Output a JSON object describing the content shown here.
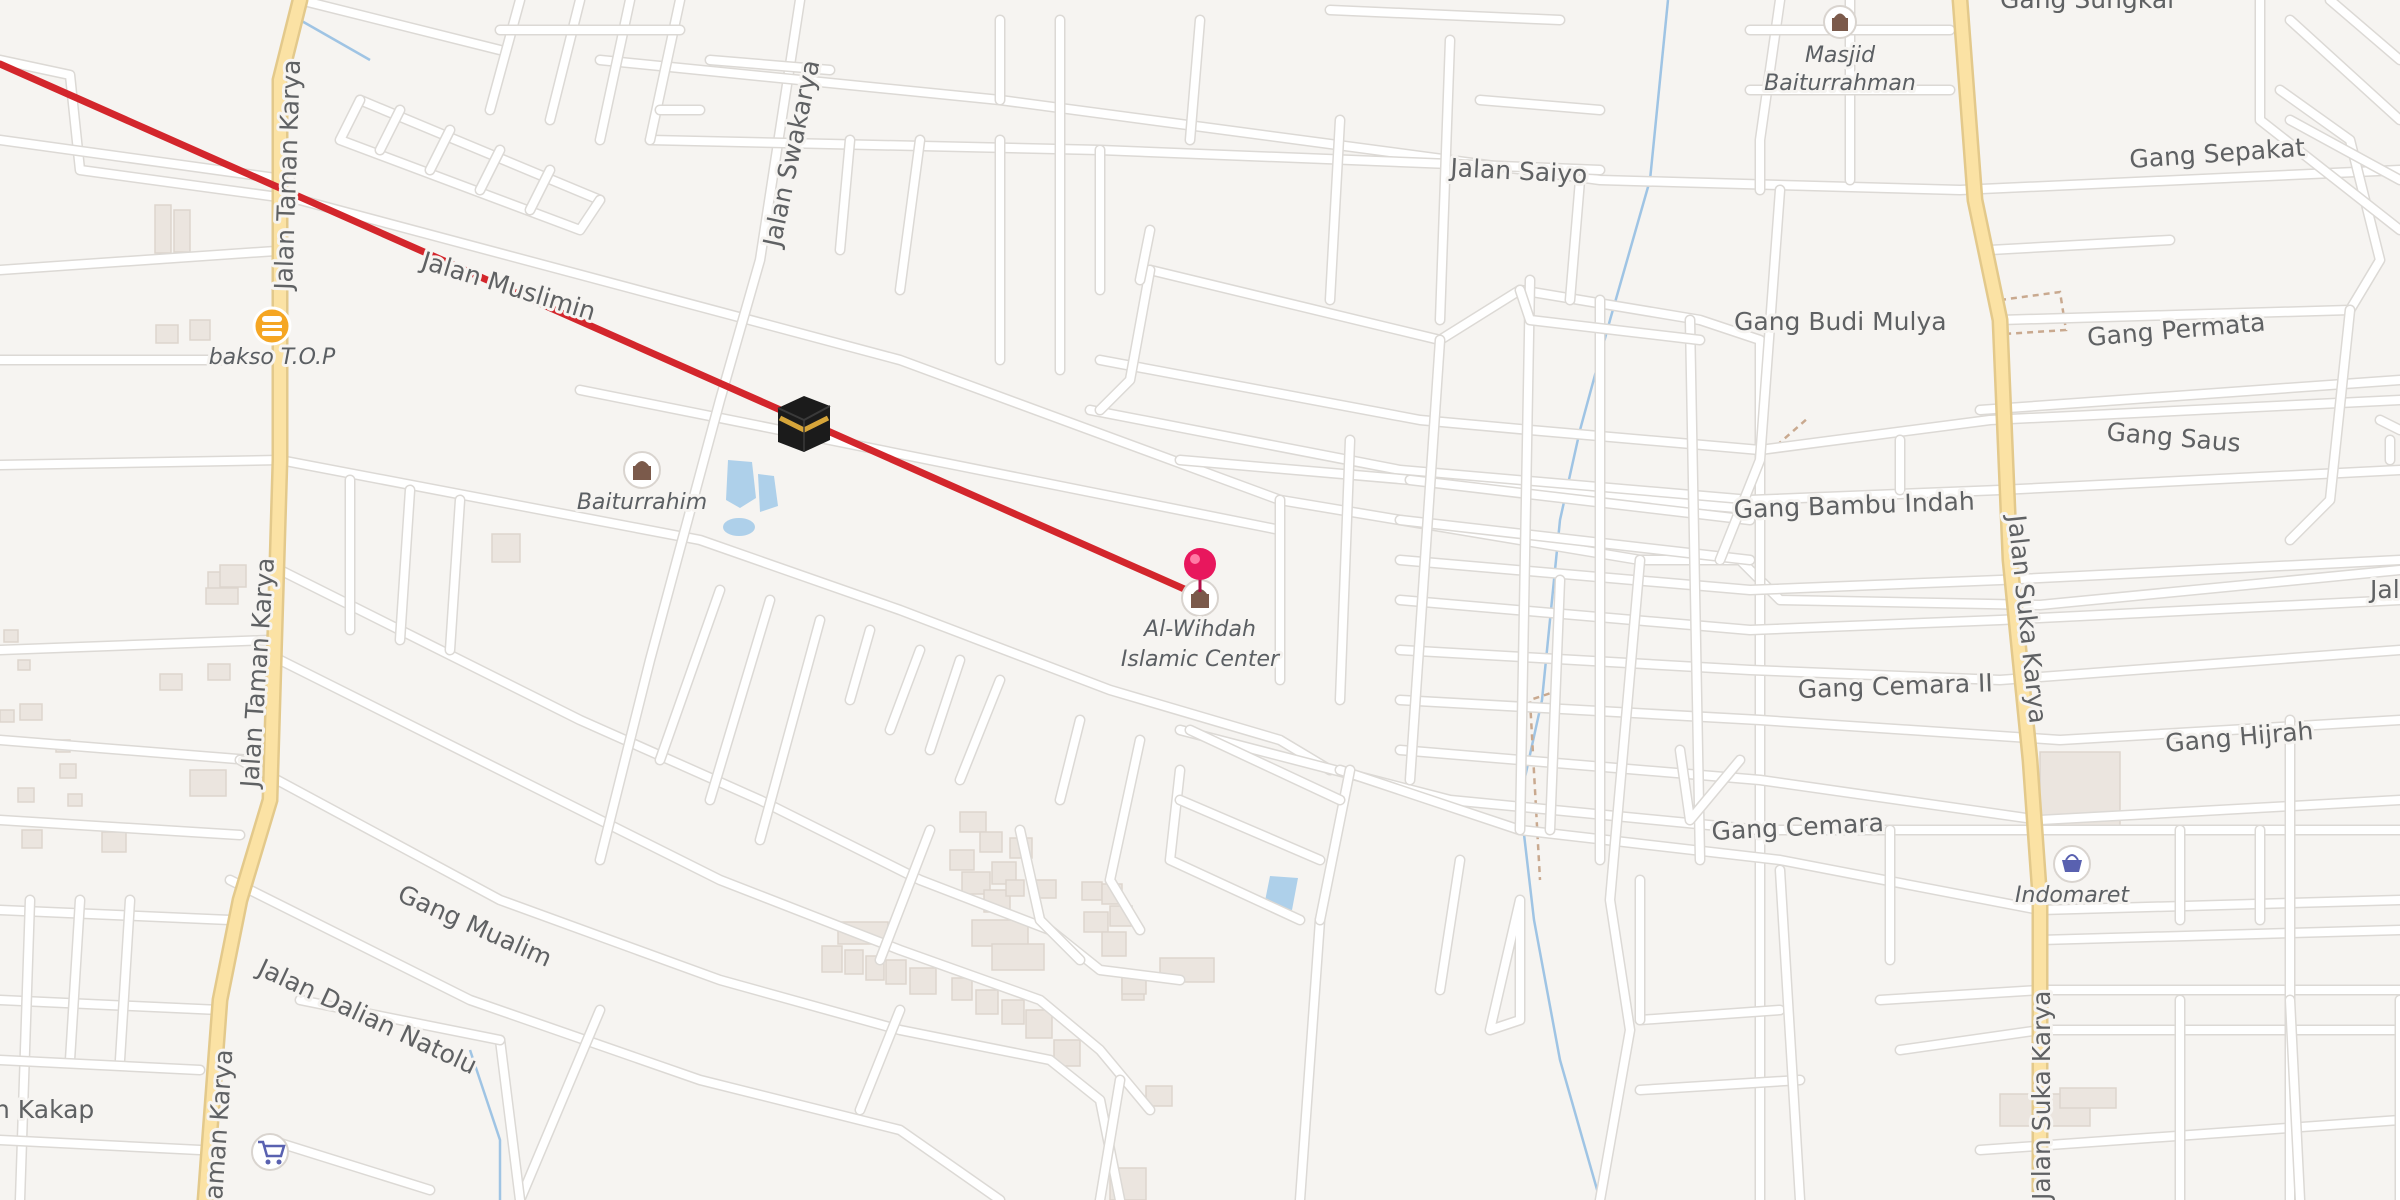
{
  "map": {
    "streets": {
      "jalan_taman_karya": "Jalan Taman Karya",
      "jalan_swakarya": "Jalan Swakarya",
      "jalan_muslimin": "Jalan Muslimin",
      "jalan_saiyo": "Jalan Saiyo",
      "gang_sungkai": "Gang Sungkai",
      "gang_sepakat": "Gang Sepakat",
      "gang_budi_mulya": "Gang Budi Mulya",
      "gang_permata": "Gang Permata",
      "gang_saus": "Gang Saus",
      "gang_bambu_indah": "Gang Bambu Indah",
      "jalan_suka_karya": "Jalan Suka Karya",
      "gang_cemara_ii": "Gang Cemara II",
      "gang_hijrah": "Gang Hijrah",
      "gang_cemara": "Gang Cemara",
      "gang_mualim": "Gang Mualim",
      "jalan_dalian_natolu": "Jalan Dalian Natolu",
      "kakap": "n Kakap",
      "jal_edge": "Jal",
      "taman_karya_bottom": "aman Karya"
    },
    "pois": {
      "masjid_baiturrahman_line1": "Masjid",
      "masjid_baiturrahman_line2": "Baiturrahman",
      "bakso_top": "bakso T.O.P",
      "baiturrahim": "Baiturrahim",
      "al_wihdah_line1": "Al-Wihdah",
      "al_wihdah_line2": "Islamic Center",
      "indomaret": "Indomaret"
    },
    "icons": {
      "mosque": "mosque-icon",
      "food": "burger-icon",
      "kaaba": "kaaba-icon",
      "location_pin": "location-pin-icon",
      "shop": "shopping-basket-icon",
      "cart": "shopping-cart-icon"
    },
    "colors": {
      "background": "#f6f4f1",
      "qibla_line": "#d3262c",
      "pin": "#e8175d",
      "main_road": "#fbe2a4",
      "water": "#aed0ea",
      "poi_icon": "#7b5a4b",
      "shop_icon": "#5961b0"
    }
  }
}
